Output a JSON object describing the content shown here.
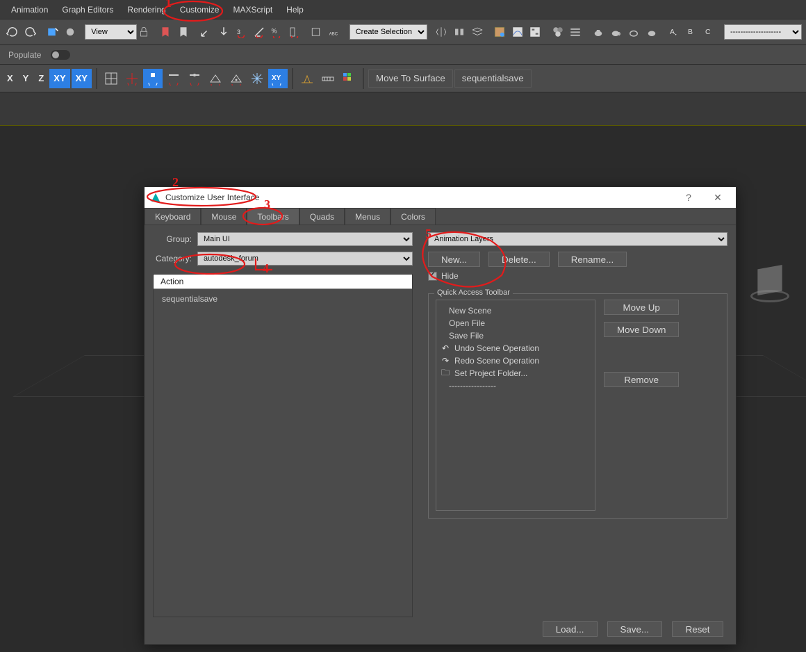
{
  "menu": {
    "items": [
      "Animation",
      "Graph Editors",
      "Rendering",
      "Customize",
      "MAXScript",
      "Help"
    ]
  },
  "toolbar": {
    "view_selector": "View",
    "selection_set_placeholder": "Create Selection Se"
  },
  "populate": {
    "label": "Populate"
  },
  "axis_row": {
    "axes": [
      "X",
      "Y",
      "Z",
      "XY",
      "XY"
    ],
    "move_to_surface": "Move To Surface",
    "sequentialsave": "sequentialsave"
  },
  "dialog": {
    "title": "Customize User Interface",
    "tabs": [
      "Keyboard",
      "Mouse",
      "Toolbars",
      "Quads",
      "Menus",
      "Colors"
    ],
    "active_tab": "Toolbars",
    "left": {
      "group_label": "Group:",
      "group_value": "Main UI",
      "category_label": "Category:",
      "category_value": "autodesk_forum",
      "action_header": "Action",
      "actions": [
        "sequentialsave"
      ]
    },
    "right": {
      "toolbar_select_value": "Animation Layers",
      "new_btn": "New...",
      "delete_btn": "Delete...",
      "rename_btn": "Rename...",
      "hide_label": "Hide",
      "qat_title": "Quick Access Toolbar",
      "qat_items": [
        {
          "label": "New Scene",
          "icon": null
        },
        {
          "label": "Open File",
          "icon": null
        },
        {
          "label": "Save File",
          "icon": null
        },
        {
          "label": "Undo Scene Operation",
          "icon": "undo"
        },
        {
          "label": "Redo Scene Operation",
          "icon": "redo"
        },
        {
          "label": "Set Project Folder...",
          "icon": "folder"
        }
      ],
      "separator_text": "-----------------",
      "move_up": "Move Up",
      "move_down": "Move Down",
      "remove": "Remove"
    },
    "footer": {
      "load": "Load...",
      "save": "Save...",
      "reset": "Reset"
    }
  },
  "annotations": {
    "n1": "1",
    "n2": "2",
    "n3": "3",
    "n4": "4",
    "n5": "5"
  }
}
